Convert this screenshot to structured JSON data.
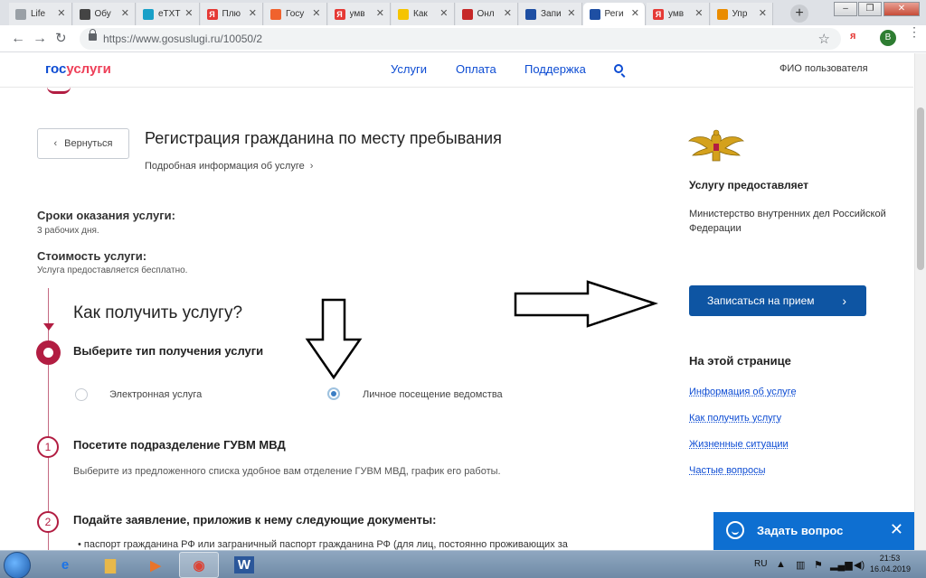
{
  "browser": {
    "tabs": [
      {
        "label": "Life",
        "fav_color": "#9aa0a6",
        "fav_text": ""
      },
      {
        "label": "Обу",
        "fav_color": "#444444",
        "fav_text": ""
      },
      {
        "label": "eTXT",
        "fav_color": "#19a0c8",
        "fav_text": ""
      },
      {
        "label": "Плю",
        "fav_color": "#e53935",
        "fav_text": "Я"
      },
      {
        "label": "Госу",
        "fav_color": "#f0622d",
        "fav_text": ""
      },
      {
        "label": "умв",
        "fav_color": "#e53935",
        "fav_text": "Я"
      },
      {
        "label": "Как",
        "fav_color": "#f5c400",
        "fav_text": ""
      },
      {
        "label": "Онл",
        "fav_color": "#c62828",
        "fav_text": ""
      },
      {
        "label": "Запи",
        "fav_color": "#1e4fa3",
        "fav_text": ""
      },
      {
        "label": "Реги",
        "fav_color": "#1e4fa3",
        "fav_text": ""
      },
      {
        "label": "умв",
        "fav_color": "#e53935",
        "fav_text": "Я"
      },
      {
        "label": "Упр",
        "fav_color": "#ea8c00",
        "fav_text": ""
      }
    ],
    "active_tab_index": 9,
    "url": "https://www.gosuslugi.ru/10050/2",
    "profile_initial": "B"
  },
  "header": {
    "logo_part1": "гос",
    "logo_part2": "услуги",
    "nav": [
      "Услуги",
      "Оплата",
      "Поддержка"
    ],
    "user": "ФИО пользователя"
  },
  "main": {
    "back_label": "Вернуться",
    "title": "Регистрация гражданина по месту пребывания",
    "more_info": "Подробная информация об услуге",
    "terms_label": "Сроки оказания услуги:",
    "terms_value": "3 рабочих дня.",
    "cost_label": "Стоимость услуги:",
    "cost_value": "Услуга предоставляется бесплатно.",
    "how_title": "Как получить услугу?",
    "choose_type": "Выберите тип получения услуги",
    "option_electronic": "Электронная услуга",
    "option_visit": "Личное посещение ведомства",
    "selected_option": "Личное посещение ведомства",
    "step1_num": "1",
    "step1_title": "Посетите подразделение ГУВМ МВД",
    "step1_desc": "Выберите из предложенного списка удобное вам отделение ГУВМ МВД, график его работы.",
    "step2_num": "2",
    "step2_title": "Подайте заявление, приложив к нему следующие документы:",
    "step2_doc": "паспорт гражданина РФ или заграничный паспорт гражданина РФ (для лиц, постоянно проживающих за"
  },
  "aside": {
    "provider_head": "Услугу предоставляет",
    "provider_name": "Министерство внутренних дел Российской Федерации",
    "cta": "Записаться на прием",
    "toc_head": "На этой странице",
    "toc_links": [
      "Информация об услуге",
      "Как получить услугу",
      "Жизненные ситуации",
      "Частые вопросы"
    ]
  },
  "ask": {
    "label": "Задать вопрос"
  },
  "taskbar": {
    "lang": "RU",
    "time": "21:53",
    "date": "16.04.2019"
  },
  "colors": {
    "brand_blue": "#0d4cd3",
    "brand_red": "#ee3f58",
    "step_crimson": "#b21d42",
    "cta_blue": "#0e55a3"
  }
}
